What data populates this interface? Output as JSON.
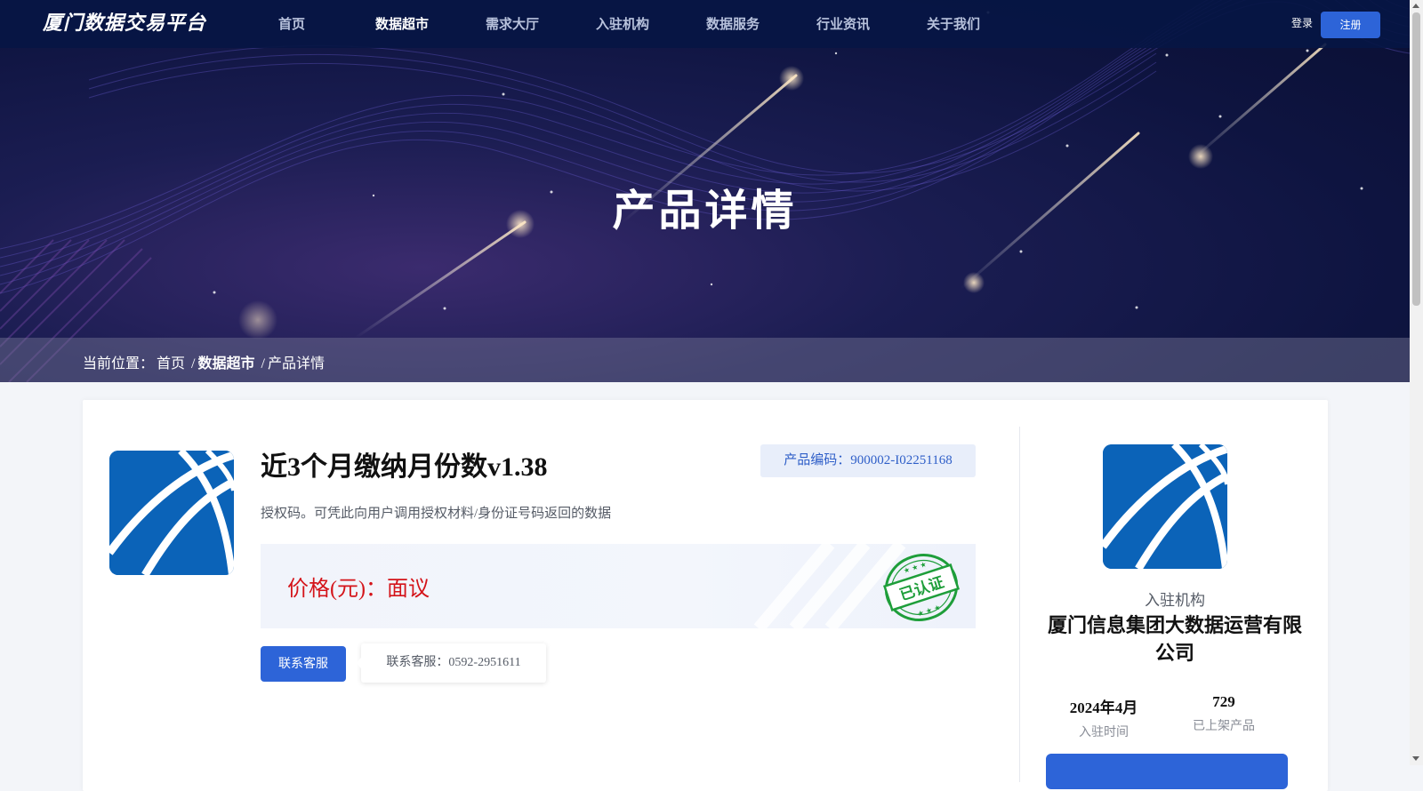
{
  "header": {
    "logo_text": "厦门数据交易平台",
    "nav": [
      {
        "label": "首页"
      },
      {
        "label": "数据超市"
      },
      {
        "label": "需求大厅"
      },
      {
        "label": "入驻机构"
      },
      {
        "label": "数据服务"
      },
      {
        "label": "行业资讯"
      },
      {
        "label": "关于我们"
      }
    ],
    "active_nav": "数据超市",
    "login_label": "登录",
    "register_label": "注册"
  },
  "hero": {
    "title": "产品详情"
  },
  "breadcrumb": {
    "prefix": "当前位置：",
    "home": "首页",
    "sep": "/",
    "section": "数据超市",
    "current": "产品详情"
  },
  "product": {
    "title": "近3个月缴纳月份数v1.38",
    "code_label": "产品编码：900002-I02251168",
    "description": "授权码。可凭此向用户调用授权材料/身份证号码返回的数据",
    "price_label": "价格(元)：面议",
    "stamp_text": "已认证",
    "contact_button": "联系客服",
    "contact_tip": "联系客服：0592-2951611"
  },
  "org": {
    "label": "入驻机构",
    "name": "厦门信息集团大数据运营有限公司",
    "joined_value": "2024年4月",
    "joined_label": "入驻时间",
    "products_value": "729",
    "products_label": "已上架产品"
  },
  "colors": {
    "primary": "#2d64d8",
    "price_red": "#d4141a",
    "stamp_green": "#1e9e3a",
    "logo_blue": "#0b63b8",
    "nav_bg": "#061644"
  }
}
